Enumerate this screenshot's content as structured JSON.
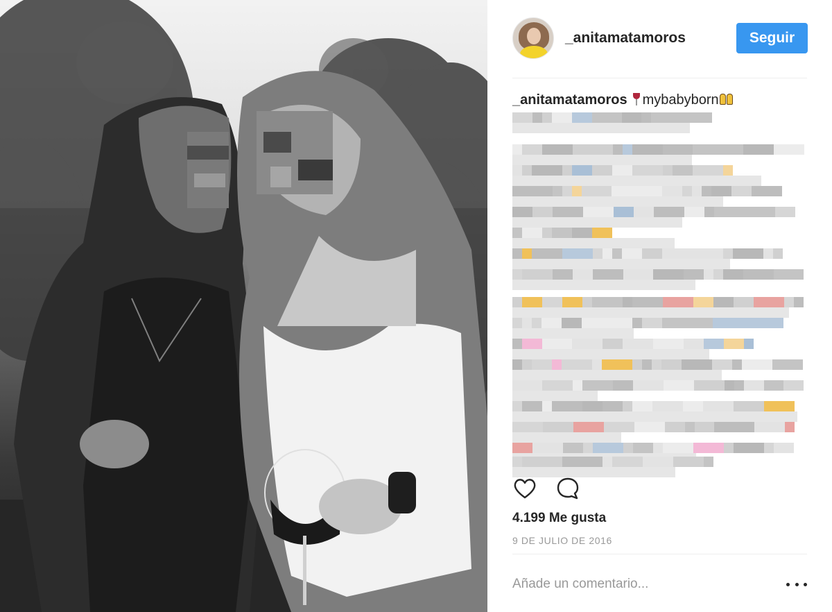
{
  "post": {
    "username": "_anitamatamoros",
    "follow_label": "Seguir",
    "caption_author": "_anitamatamoros",
    "caption_text": "mybabyborn",
    "caption_emoji_before": "wine-glass-icon",
    "caption_emoji_after": "dancers-icon",
    "likes": "4.199 Me gusta",
    "date": "9 DE JULIO DE 2016",
    "comment_placeholder": "Añade un comentario...",
    "like_icon": "heart-icon",
    "comment_icon": "comment-bubble-icon",
    "more_icon": "more-options-icon"
  },
  "colors": {
    "accent": "#3897f0",
    "text": "#262626",
    "muted": "#999999",
    "divider": "#efefef"
  }
}
